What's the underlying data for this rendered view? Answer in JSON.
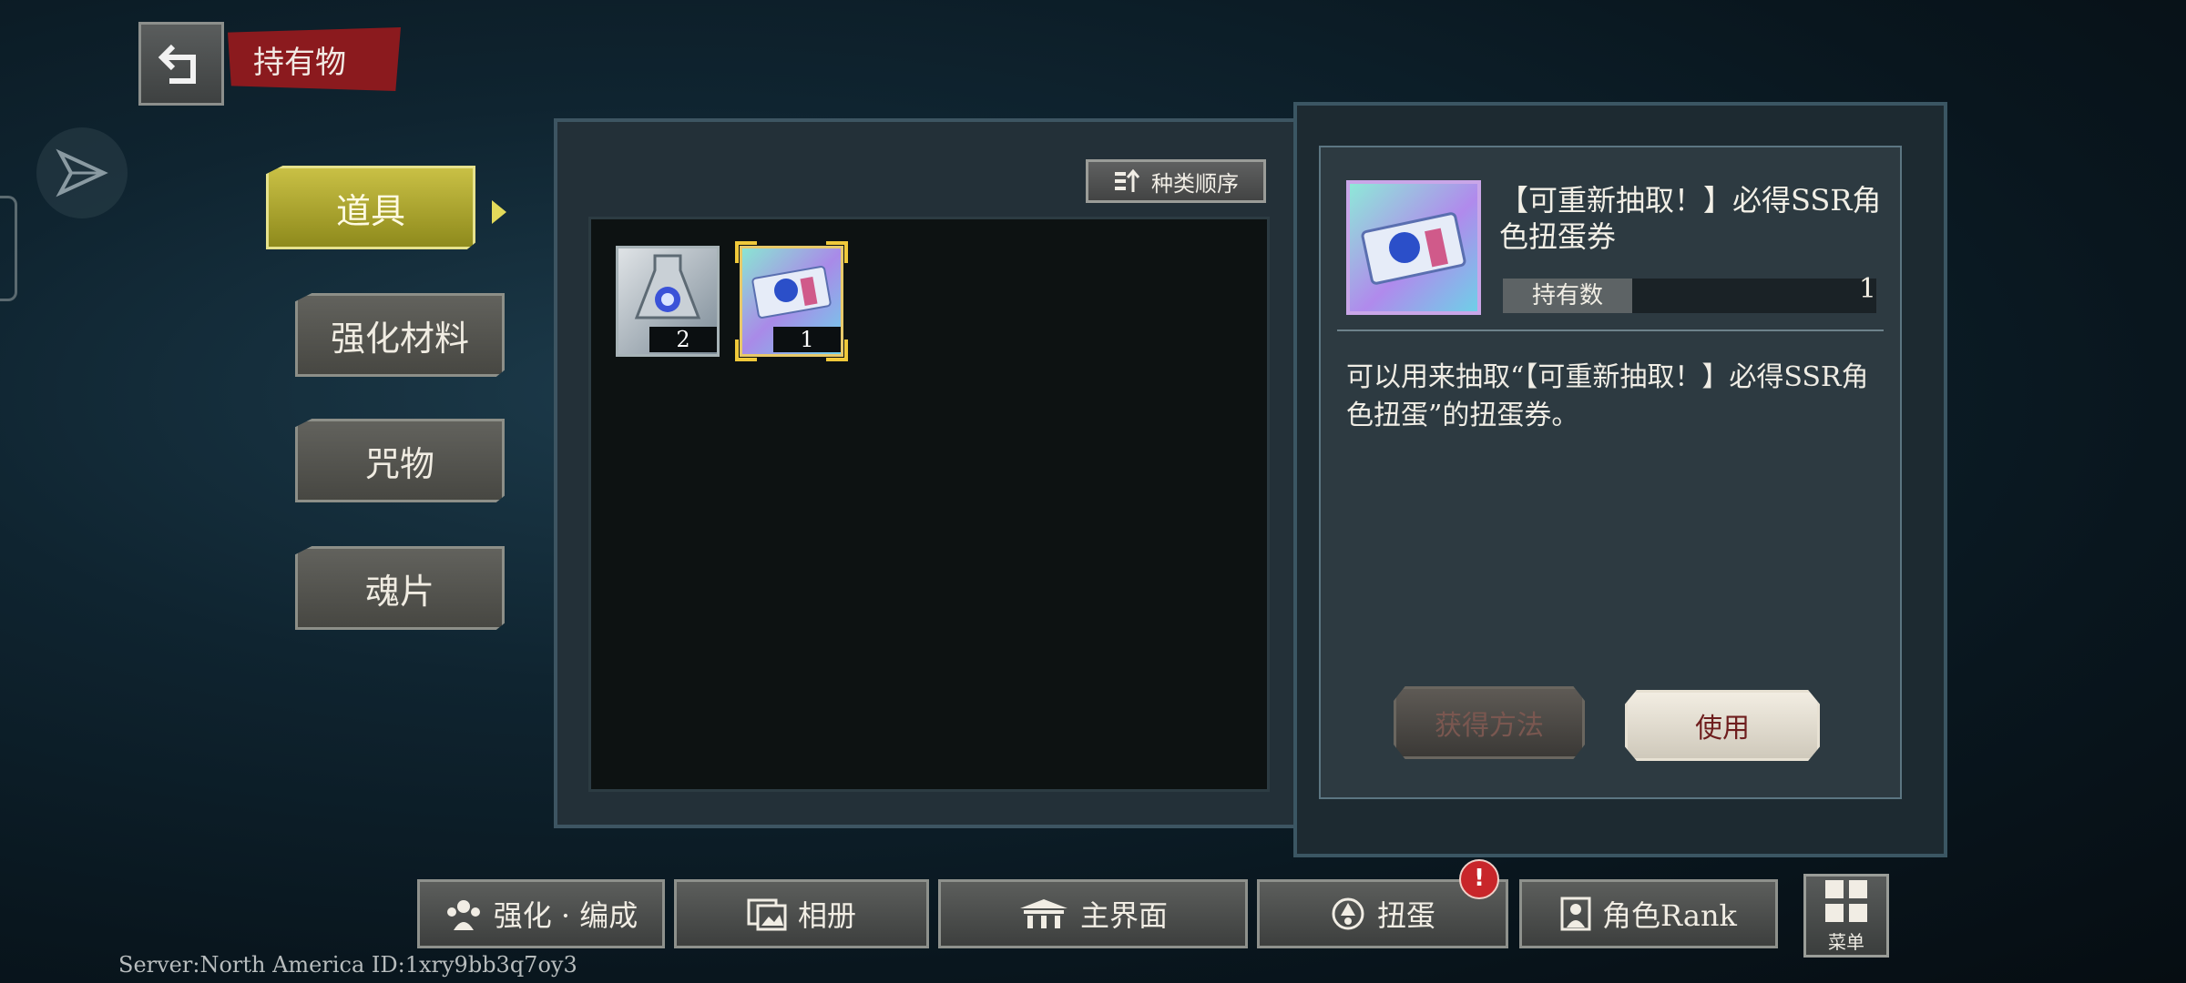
{
  "header": {
    "title": "持有物"
  },
  "categories": [
    {
      "label": "道具",
      "active": true
    },
    {
      "label": "强化材料",
      "active": false
    },
    {
      "label": "咒物",
      "active": false
    },
    {
      "label": "魂片",
      "active": false
    }
  ],
  "inventory": {
    "sort_label": "种类顺序",
    "items": [
      {
        "count": "2",
        "icon": "crystal-flask-icon",
        "selected": false
      },
      {
        "count": "1",
        "icon": "gacha-ticket-icon",
        "selected": true
      }
    ]
  },
  "detail": {
    "name": "【可重新抽取！】必得SSR角色扭蛋券",
    "held_label": "持有数",
    "held_value": "1",
    "description": "可以用来抽取“【可重新抽取！】必得SSR角色扭蛋”的扭蛋券。",
    "obtain_label": "获得方法",
    "use_label": "使用"
  },
  "nav": {
    "items": [
      {
        "label": "强化 · 编成",
        "icon": "team-icon"
      },
      {
        "label": "相册",
        "icon": "album-icon"
      },
      {
        "label": "主界面",
        "icon": "home-icon"
      },
      {
        "label": "扭蛋",
        "icon": "gacha-icon"
      },
      {
        "label": "角色Rank",
        "icon": "rank-icon"
      }
    ],
    "alert": "!",
    "menu_label": "菜单"
  },
  "footer": {
    "server": "Server:North America ID:1xry9bb3q7oy3"
  },
  "colors": {
    "accent": "#c9c045",
    "alert": "#c8262a",
    "title_tag": "#8b1a1e"
  }
}
